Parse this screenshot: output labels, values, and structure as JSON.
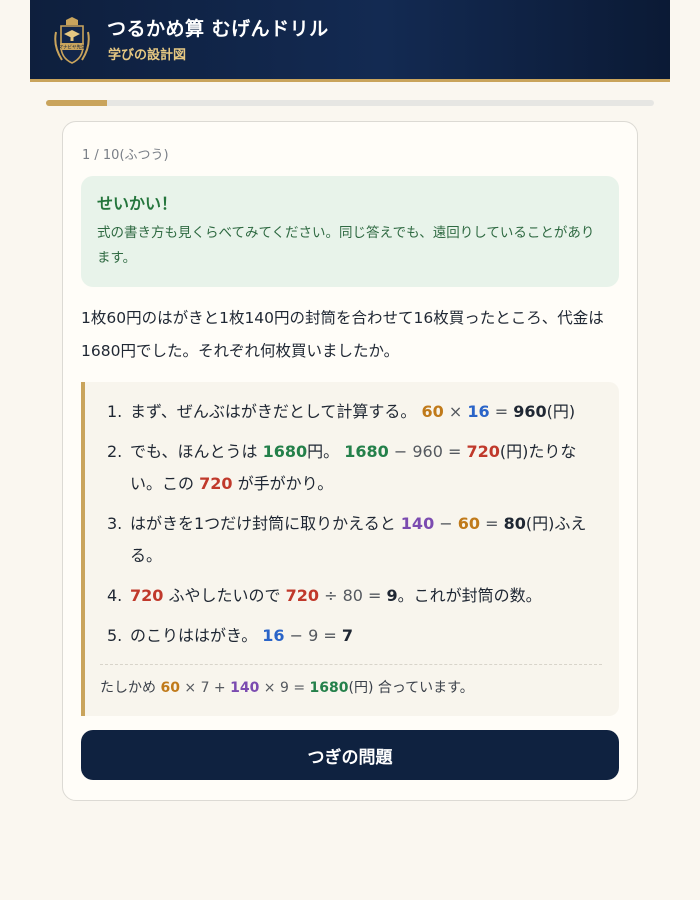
{
  "header": {
    "title": "つるかめ算  むげんドリル",
    "subtitle": "学びの設計図",
    "logo_text": "マナビヤ先生",
    "logo_icon": "academic-crest-icon",
    "colors": {
      "bg": "#0e1f3d",
      "accent": "#c9a45c"
    }
  },
  "progress": {
    "current": 1,
    "total": 10,
    "fraction": 0.1
  },
  "quiz": {
    "counter": "1 / 10(ふつう)",
    "feedback": {
      "title": "せいかい！",
      "message": "式の書き方も見くらべてみてください。同じ答えでも、遠回りしていることがあります。"
    },
    "question": "1枚60円のはがきと1枚140円の封筒を合わせて16枚買ったところ、代金は1680円でした。それぞれ何枚買いましたか。",
    "steps": [
      {
        "num": "1.",
        "parts": [
          {
            "t": "まず、ぜんぶはがきだとして計算する。 "
          },
          {
            "t": "60",
            "c": "gold"
          },
          {
            "t": " × ",
            "c": "op"
          },
          {
            "t": "16",
            "c": "blue"
          },
          {
            "t": " = ",
            "c": "op"
          },
          {
            "t": "960",
            "c": "bold"
          },
          {
            "t": "(円)"
          }
        ]
      },
      {
        "num": "2.",
        "parts": [
          {
            "t": "でも、ほんとうは "
          },
          {
            "t": "1680",
            "c": "green"
          },
          {
            "t": "円。 "
          },
          {
            "t": "1680",
            "c": "green"
          },
          {
            "t": " − 960 = ",
            "c": "op"
          },
          {
            "t": "720",
            "c": "red"
          },
          {
            "t": "(円)たりない。この "
          },
          {
            "t": "720",
            "c": "red"
          },
          {
            "t": " が手がかり。"
          }
        ]
      },
      {
        "num": "3.",
        "parts": [
          {
            "t": "はがきを1つだけ封筒に取りかえると "
          },
          {
            "t": "140",
            "c": "purple"
          },
          {
            "t": " − ",
            "c": "op"
          },
          {
            "t": "60",
            "c": "gold"
          },
          {
            "t": " = ",
            "c": "op"
          },
          {
            "t": "80",
            "c": "bold"
          },
          {
            "t": "(円)ふえる。"
          }
        ]
      },
      {
        "num": "4.",
        "parts": [
          {
            "t": "720",
            "c": "red"
          },
          {
            "t": " ふやしたいので  "
          },
          {
            "t": "720",
            "c": "red"
          },
          {
            "t": " ÷ 80 = ",
            "c": "op"
          },
          {
            "t": "9",
            "c": "bold"
          },
          {
            "t": "。これが封筒の数。"
          }
        ]
      },
      {
        "num": "5.",
        "parts": [
          {
            "t": "のこりははがき。 "
          },
          {
            "t": "16",
            "c": "blue"
          },
          {
            "t": " − 9 = ",
            "c": "op"
          },
          {
            "t": "7",
            "c": "bold"
          }
        ]
      }
    ],
    "check": {
      "parts": [
        {
          "t": "たしかめ  "
        },
        {
          "t": "60",
          "c": "gold"
        },
        {
          "t": " × 7 + ",
          "c": "op"
        },
        {
          "t": "140",
          "c": "purple"
        },
        {
          "t": " × 9 = ",
          "c": "op"
        },
        {
          "t": "1680",
          "c": "green"
        },
        {
          "t": "(円)  合っています。"
        }
      ]
    },
    "next_button": "つぎの問題"
  }
}
